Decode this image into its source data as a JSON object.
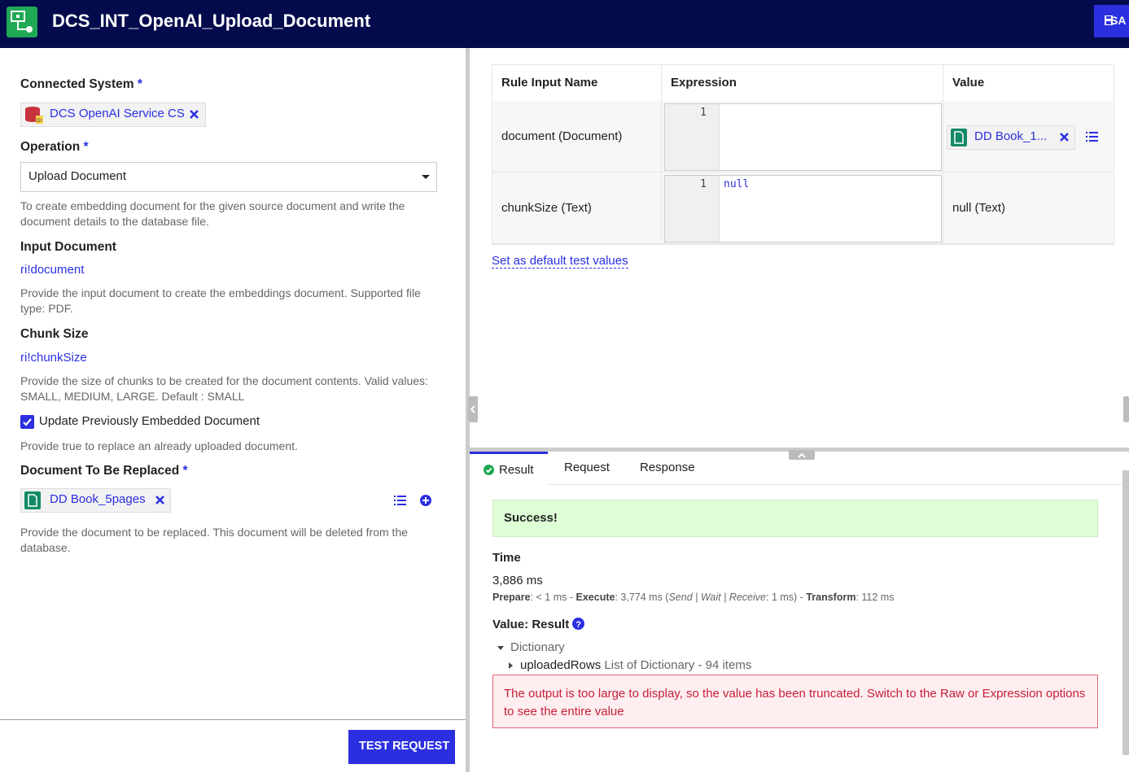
{
  "header": {
    "title": "DCS_INT_OpenAI_Upload_Document",
    "save_label": "SA",
    "app_icon": "process-model-icon",
    "colors": {
      "bar": "#030b4d",
      "accent": "#2b2fe0",
      "icon_bg": "#1fa855"
    }
  },
  "form": {
    "connected_system": {
      "label": "Connected System",
      "required": "*",
      "value": "DCS OpenAI Service CS"
    },
    "operation": {
      "label": "Operation",
      "required": "*",
      "value": "Upload Document",
      "description": "To create embedding document for the given source document and write the document details to the database file."
    },
    "input_document": {
      "label": "Input Document",
      "value": "ri!document",
      "description": "Provide the input document to create the embeddings document. Supported file type: PDF."
    },
    "chunk_size": {
      "label": "Chunk Size",
      "value": "ri!chunkSize",
      "description": "Provide the size of chunks to be created for the document contents. Valid values: SMALL, MEDIUM, LARGE. Default : SMALL"
    },
    "update_previous": {
      "label": "Update Previously Embedded Document",
      "checked": true,
      "description": "Provide true to replace an already uploaded document."
    },
    "doc_to_replace": {
      "label": "Document To Be Replaced",
      "required": "*",
      "value": "DD Book_5pages",
      "description": "Provide the document to be replaced. This document will be deleted from the database."
    },
    "test_request_label": "TEST REQUEST"
  },
  "rule_inputs": {
    "headers": [
      "Rule Input Name",
      "Expression",
      "Value"
    ],
    "rows": [
      {
        "name": "document (Document)",
        "line": "1",
        "expression": "",
        "value": "DD Book_1..."
      },
      {
        "name": "chunkSize (Text)",
        "line": "1",
        "expression": "null",
        "value": "null (Text)"
      }
    ],
    "set_default_label": "Set as default test values"
  },
  "result": {
    "tabs": [
      "Result",
      "Request",
      "Response"
    ],
    "active_tab": "Result",
    "status": "Success!",
    "time_label": "Time",
    "time_value": "3,886 ms",
    "timing": {
      "prepare_label": "Prepare",
      "prepare": "< 1 ms",
      "execute_label": "Execute",
      "execute": "3,774 ms",
      "swr": "Send | Wait | Receive",
      "swr_value": "1 ms",
      "transform_label": "Transform",
      "transform": "112 ms"
    },
    "value_label": "Value: Result",
    "tree": {
      "root": "Dictionary",
      "child": "uploadedRows",
      "child_meta": "List of Dictionary - 94 items"
    },
    "error": "The output is too large to display, so the value has been truncated. Switch to the Raw or Expression options to see the entire value"
  }
}
